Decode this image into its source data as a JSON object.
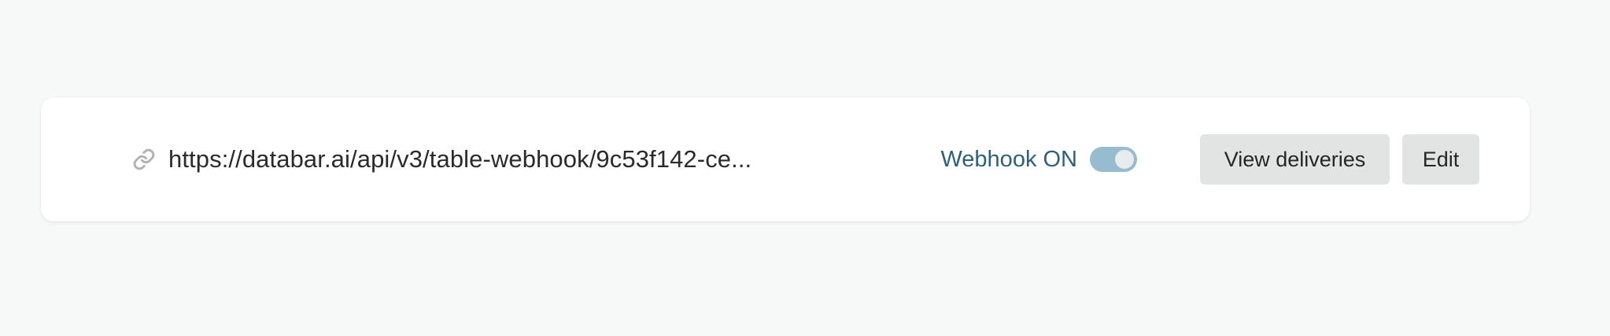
{
  "webhook": {
    "url": "https://databar.ai/api/v3/table-webhook/9c53f142-ce...",
    "status_label": "Webhook ON",
    "enabled": true
  },
  "actions": {
    "view_deliveries_label": "View deliveries",
    "edit_label": "Edit"
  },
  "icons": {
    "url": "link-icon"
  },
  "colors": {
    "background": "#f7f8f8",
    "card": "#ffffff",
    "status_text": "#2f6076",
    "toggle_on": "#97bcd0",
    "button_bg": "#e2e3e3"
  }
}
